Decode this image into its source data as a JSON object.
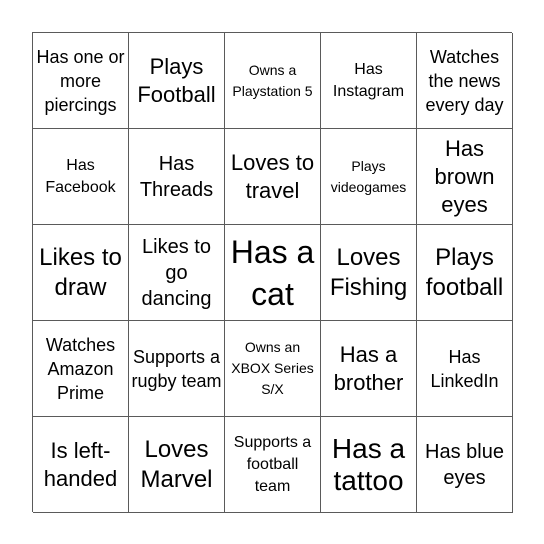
{
  "board": {
    "rows": [
      [
        "Has one or more piercings",
        "Plays Football",
        "Owns a Playstation 5",
        "Has Instagram",
        "Watches the news every day"
      ],
      [
        "Has Facebook",
        "Has Threads",
        "Loves to travel",
        "Plays videogames",
        "Has brown eyes"
      ],
      [
        "Likes to draw",
        "Likes to go dancing",
        "Has a cat",
        "Loves Fishing",
        "Plays football"
      ],
      [
        "Watches Amazon Prime",
        "Supports a rugby team",
        "Owns an XBOX Series S/X",
        "Has a brother",
        "Has LinkedIn"
      ],
      [
        "Is left-handed",
        "Loves Marvel",
        "Supports a football team",
        "Has a tattoo",
        "Has blue eyes"
      ]
    ]
  }
}
